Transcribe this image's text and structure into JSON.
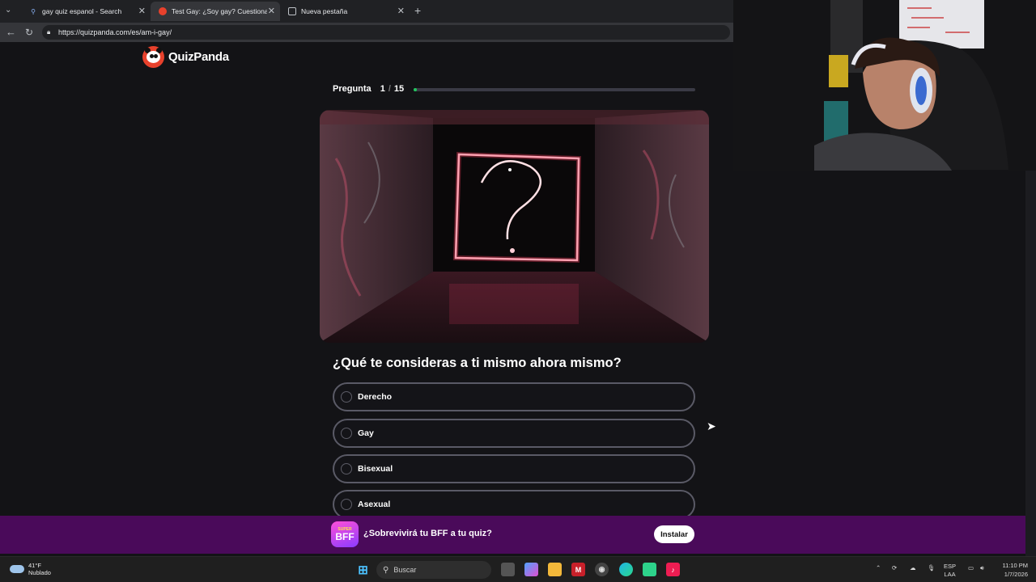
{
  "browser": {
    "tabs": [
      {
        "label": "gay quiz espanol - Search"
      },
      {
        "label": "Test Gay: ¿Soy gay? Cuestionario |"
      },
      {
        "label": "Nueva pestaña"
      }
    ],
    "url": "https://quizpanda.com/es/am-i-gay/"
  },
  "site": {
    "logo_text": "QuizPanda"
  },
  "quiz": {
    "question_label": "Pregunta",
    "current": "1",
    "separator": "/",
    "total": "15",
    "progress": 0.01,
    "question": "¿Qué te consideras a ti mismo ahora mismo?",
    "options": [
      {
        "label": "Derecho"
      },
      {
        "label": "Gay"
      },
      {
        "label": "Bisexual"
      },
      {
        "label": "Asexual"
      }
    ]
  },
  "banner": {
    "icon_top": "SUPER",
    "icon_main": "BFF",
    "text": "¿Sobrevivirá tu BFF a tu quiz?",
    "button": "Instalar"
  },
  "taskbar": {
    "temp": "41°F",
    "condition": "Nublado",
    "search_placeholder": "Buscar",
    "lang_top": "ESP",
    "lang_bottom": "LAA",
    "time": "11:10 PM",
    "date": "1/7/2026"
  },
  "colors": {
    "progress": "#22c55e",
    "banner": "#4a0a5a",
    "brand": "#e8412c"
  }
}
